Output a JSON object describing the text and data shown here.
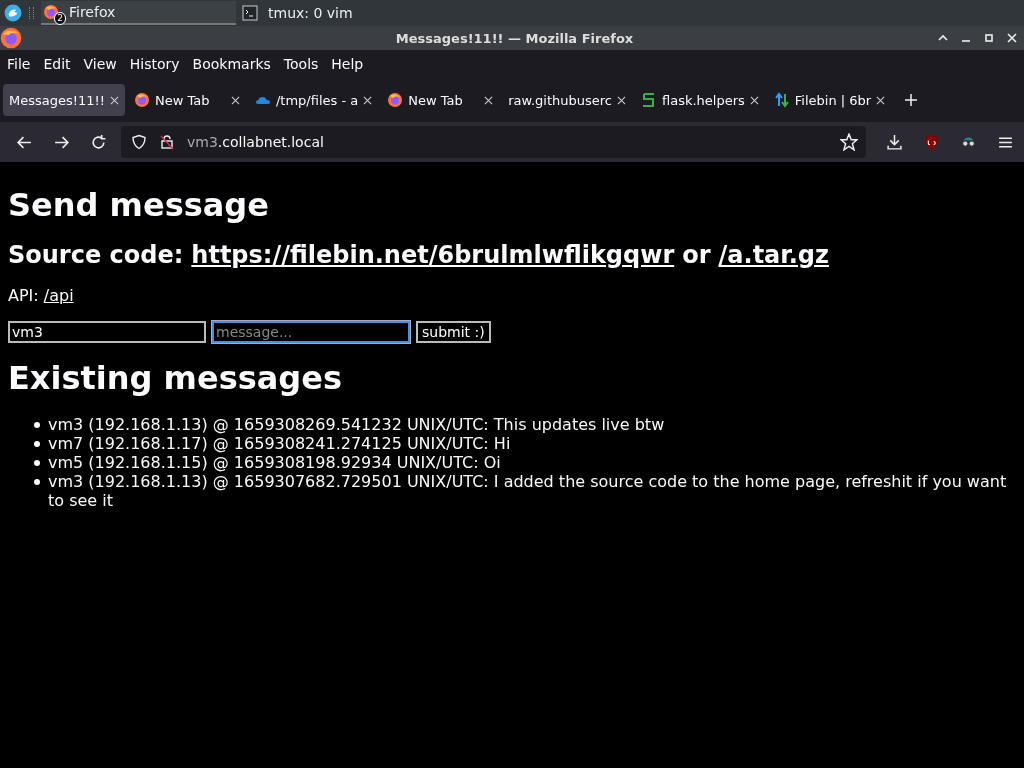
{
  "taskbar": {
    "tasks": [
      {
        "label": "Firefox",
        "kind": "firefox",
        "badge": "2",
        "selected": true
      },
      {
        "label": "tmux: 0 vim",
        "kind": "terminal",
        "selected": false
      }
    ]
  },
  "window": {
    "title": "Messages!11!! — Mozilla Firefox"
  },
  "menu": [
    "File",
    "Edit",
    "View",
    "History",
    "Bookmarks",
    "Tools",
    "Help"
  ],
  "tabs": [
    {
      "label": "Messages!11!!",
      "kind": "plain",
      "selected": true
    },
    {
      "label": "New Tab",
      "kind": "firefox",
      "selected": false
    },
    {
      "label": "/tmp/files - a",
      "kind": "cloud",
      "selected": false
    },
    {
      "label": "New Tab",
      "kind": "firefox",
      "selected": false
    },
    {
      "label": "raw.githubuserc",
      "kind": "plain",
      "selected": false
    },
    {
      "label": "flask.helpers",
      "kind": "flask",
      "selected": false
    },
    {
      "label": "Filebin | 6br",
      "kind": "filebin",
      "selected": false
    }
  ],
  "address_bar": {
    "url_prefix": "vm3",
    "url_rest": ".collabnet.local"
  },
  "page": {
    "heading": "Send message",
    "source_label": "Source code:",
    "source_link": "https://filebin.net/6brulmlwflikgqwr",
    "source_or": "or",
    "source_link_2": "/a.tar.gz",
    "api_label": "API:",
    "api_link": "/api",
    "form": {
      "name_value": "vm3",
      "message_placeholder": "message...",
      "submit": "submit :)"
    },
    "messages_heading": "Existing messages",
    "messages": [
      "vm3 (192.168.1.13) @ 1659308269.541232 UNIX/UTC: This updates live btw",
      "vm7 (192.168.1.17) @ 1659308241.274125 UNIX/UTC: Hi",
      "vm5 (192.168.1.15) @ 1659308198.92934 UNIX/UTC: Oi",
      "vm3 (192.168.1.13) @ 1659307682.729501 UNIX/UTC: I added the source code to the home page, refreshit if you want to see it"
    ]
  }
}
